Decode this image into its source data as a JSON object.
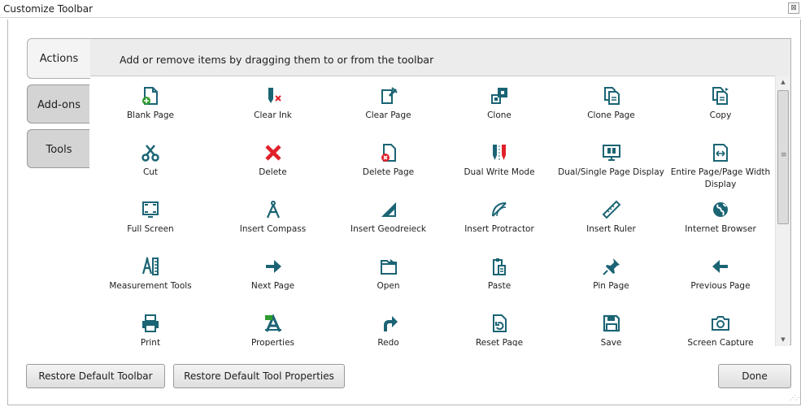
{
  "window": {
    "title": "Customize Toolbar",
    "close_glyph": "⊠"
  },
  "tabs": [
    {
      "label": "Actions",
      "active": true
    },
    {
      "label": "Add-ons",
      "active": false
    },
    {
      "label": "Tools",
      "active": false
    }
  ],
  "hint": "Add or remove items by dragging them to or from the toolbar",
  "colors": {
    "teal": "#1b6474",
    "green": "#2e9a2e",
    "red": "#e0202a",
    "panel": "#ececec"
  },
  "items": [
    {
      "label": "Blank Page",
      "icon": "blank-page-icon"
    },
    {
      "label": "Clear Ink",
      "icon": "clear-ink-icon"
    },
    {
      "label": "Clear Page",
      "icon": "clear-page-icon"
    },
    {
      "label": "Clone",
      "icon": "clone-icon"
    },
    {
      "label": "Clone Page",
      "icon": "clone-page-icon"
    },
    {
      "label": "Copy",
      "icon": "copy-icon"
    },
    {
      "label": "Cut",
      "icon": "scissors-icon"
    },
    {
      "label": "Delete",
      "icon": "delete-x-icon"
    },
    {
      "label": "Delete Page",
      "icon": "delete-page-icon"
    },
    {
      "label": "Dual Write Mode",
      "icon": "dual-pens-icon"
    },
    {
      "label": "Dual/Single Page Display",
      "icon": "monitor-page-icon"
    },
    {
      "label": "Entire Page/Page Width Display",
      "icon": "page-width-icon"
    },
    {
      "label": "Full Screen",
      "icon": "full-screen-icon"
    },
    {
      "label": "Insert Compass",
      "icon": "compass-icon"
    },
    {
      "label": "Insert Geodreieck",
      "icon": "geodreieck-icon"
    },
    {
      "label": "Insert Protractor",
      "icon": "protractor-icon"
    },
    {
      "label": "Insert Ruler",
      "icon": "ruler-icon"
    },
    {
      "label": "Internet Browser",
      "icon": "globe-icon"
    },
    {
      "label": "Measurement Tools",
      "icon": "measurement-tools-icon"
    },
    {
      "label": "Next Page",
      "icon": "arrow-right-icon"
    },
    {
      "label": "Open",
      "icon": "open-folder-icon"
    },
    {
      "label": "Paste",
      "icon": "paste-icon"
    },
    {
      "label": "Pin Page",
      "icon": "pin-icon"
    },
    {
      "label": "Previous Page",
      "icon": "arrow-left-icon"
    },
    {
      "label": "Print",
      "icon": "printer-icon"
    },
    {
      "label": "Properties",
      "icon": "properties-icon"
    },
    {
      "label": "Redo",
      "icon": "redo-icon"
    },
    {
      "label": "Reset Page",
      "icon": "reset-page-icon"
    },
    {
      "label": "Save",
      "icon": "save-icon"
    },
    {
      "label": "Screen Capture",
      "icon": "camera-icon"
    }
  ],
  "scrollbar": {
    "up_glyph": "▲",
    "down_glyph": "▼",
    "grip_glyph": "≡"
  },
  "buttons": {
    "restore_toolbar": "Restore Default Toolbar",
    "restore_properties": "Restore Default Tool Properties",
    "done": "Done"
  }
}
